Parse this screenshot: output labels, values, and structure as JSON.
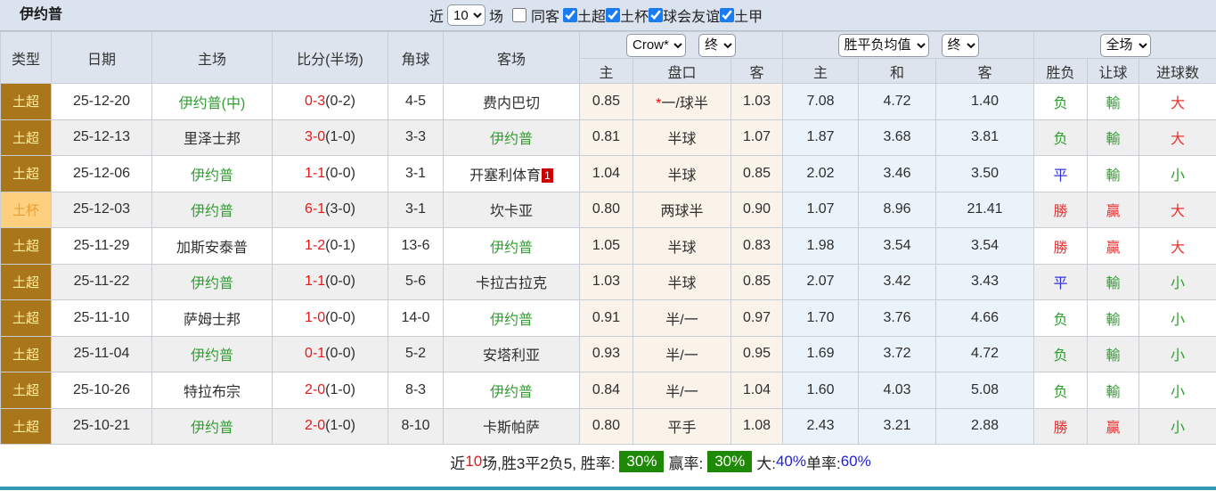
{
  "topbar": {
    "title": "伊约普",
    "recent_label": "近",
    "recent_value": "10",
    "matches_label": "场",
    "same_away": {
      "label": "同客",
      "checked": false
    },
    "leagues": [
      {
        "label": "土超",
        "checked": true
      },
      {
        "label": "土杯",
        "checked": true
      },
      {
        "label": "球会友谊",
        "checked": true
      },
      {
        "label": "土甲",
        "checked": true
      }
    ]
  },
  "header": {
    "group_cols": [
      "类型",
      "日期",
      "主场",
      "比分(半场)",
      "角球",
      "客场"
    ],
    "selects": {
      "company": "Crow*",
      "company_state": "终",
      "avg": "胜平负均值",
      "avg_state": "终",
      "scope": "全场"
    },
    "sub_cols": [
      "主",
      "盘口",
      "客",
      "主",
      "和",
      "客",
      "胜负",
      "让球",
      "进球数"
    ]
  },
  "rows": [
    {
      "type": {
        "text": "土超",
        "style": "super"
      },
      "date": "25-12-20",
      "home": {
        "text": "伊约普(中)",
        "self": true
      },
      "score": {
        "ft": "0-3",
        "ht": "(0-2)"
      },
      "corners": "4-5",
      "away": {
        "text": "费内巴切",
        "self": false
      },
      "odds": {
        "home": "0.85",
        "star": true,
        "handicap": "一/球半",
        "away": "1.03"
      },
      "avg": {
        "home": "7.08",
        "draw": "4.72",
        "away": "1.40"
      },
      "result": {
        "text": "负",
        "c": "g"
      },
      "hresult": {
        "text": "輸",
        "c": "g"
      },
      "goals": {
        "text": "大",
        "c": "r"
      }
    },
    {
      "type": {
        "text": "土超",
        "style": "super"
      },
      "date": "25-12-13",
      "home": {
        "text": "里泽士邦",
        "self": false
      },
      "score": {
        "ft": "3-0",
        "ht": "(1-0)"
      },
      "corners": "3-3",
      "away": {
        "text": "伊约普",
        "self": true
      },
      "odds": {
        "home": "0.81",
        "star": false,
        "handicap": "半球",
        "away": "1.07"
      },
      "avg": {
        "home": "1.87",
        "draw": "3.68",
        "away": "3.81"
      },
      "result": {
        "text": "负",
        "c": "g"
      },
      "hresult": {
        "text": "輸",
        "c": "g"
      },
      "goals": {
        "text": "大",
        "c": "r"
      }
    },
    {
      "type": {
        "text": "土超",
        "style": "super"
      },
      "date": "25-12-06",
      "home": {
        "text": "伊约普",
        "self": true
      },
      "score": {
        "ft": "1-1",
        "ht": "(0-0)"
      },
      "corners": "3-1",
      "away": {
        "text": "开塞利体育",
        "self": false,
        "badge": "1"
      },
      "odds": {
        "home": "1.04",
        "star": false,
        "handicap": "半球",
        "away": "0.85"
      },
      "avg": {
        "home": "2.02",
        "draw": "3.46",
        "away": "3.50"
      },
      "result": {
        "text": "平",
        "c": "b"
      },
      "hresult": {
        "text": "輸",
        "c": "g"
      },
      "goals": {
        "text": "小",
        "c": "g"
      }
    },
    {
      "type": {
        "text": "土杯",
        "style": "cup"
      },
      "date": "25-12-03",
      "home": {
        "text": "伊约普",
        "self": true
      },
      "score": {
        "ft": "6-1",
        "ht": "(3-0)"
      },
      "corners": "3-1",
      "away": {
        "text": "坎卡亚",
        "self": false
      },
      "odds": {
        "home": "0.80",
        "star": false,
        "handicap": "两球半",
        "away": "0.90"
      },
      "avg": {
        "home": "1.07",
        "draw": "8.96",
        "away": "21.41"
      },
      "result": {
        "text": "勝",
        "c": "r"
      },
      "hresult": {
        "text": "贏",
        "c": "r"
      },
      "goals": {
        "text": "大",
        "c": "r"
      }
    },
    {
      "type": {
        "text": "土超",
        "style": "super"
      },
      "date": "25-11-29",
      "home": {
        "text": "加斯安泰普",
        "self": false
      },
      "score": {
        "ft": "1-2",
        "ht": "(0-1)"
      },
      "corners": "13-6",
      "away": {
        "text": "伊约普",
        "self": true
      },
      "odds": {
        "home": "1.05",
        "star": false,
        "handicap": "半球",
        "away": "0.83"
      },
      "avg": {
        "home": "1.98",
        "draw": "3.54",
        "away": "3.54"
      },
      "result": {
        "text": "勝",
        "c": "r"
      },
      "hresult": {
        "text": "贏",
        "c": "r"
      },
      "goals": {
        "text": "大",
        "c": "r"
      }
    },
    {
      "type": {
        "text": "土超",
        "style": "super"
      },
      "date": "25-11-22",
      "home": {
        "text": "伊约普",
        "self": true
      },
      "score": {
        "ft": "1-1",
        "ht": "(0-0)"
      },
      "corners": "5-6",
      "away": {
        "text": "卡拉古拉克",
        "self": false
      },
      "odds": {
        "home": "1.03",
        "star": false,
        "handicap": "半球",
        "away": "0.85"
      },
      "avg": {
        "home": "2.07",
        "draw": "3.42",
        "away": "3.43"
      },
      "result": {
        "text": "平",
        "c": "b"
      },
      "hresult": {
        "text": "輸",
        "c": "g"
      },
      "goals": {
        "text": "小",
        "c": "g"
      }
    },
    {
      "type": {
        "text": "土超",
        "style": "super"
      },
      "date": "25-11-10",
      "home": {
        "text": "萨姆士邦",
        "self": false
      },
      "score": {
        "ft": "1-0",
        "ht": "(0-0)"
      },
      "corners": "14-0",
      "away": {
        "text": "伊约普",
        "self": true
      },
      "odds": {
        "home": "0.91",
        "star": false,
        "handicap": "半/一",
        "away": "0.97"
      },
      "avg": {
        "home": "1.70",
        "draw": "3.76",
        "away": "4.66"
      },
      "result": {
        "text": "负",
        "c": "g"
      },
      "hresult": {
        "text": "輸",
        "c": "g"
      },
      "goals": {
        "text": "小",
        "c": "g"
      }
    },
    {
      "type": {
        "text": "土超",
        "style": "super"
      },
      "date": "25-11-04",
      "home": {
        "text": "伊约普",
        "self": true
      },
      "score": {
        "ft": "0-1",
        "ht": "(0-0)"
      },
      "corners": "5-2",
      "away": {
        "text": "安塔利亚",
        "self": false
      },
      "odds": {
        "home": "0.93",
        "star": false,
        "handicap": "半/一",
        "away": "0.95"
      },
      "avg": {
        "home": "1.69",
        "draw": "3.72",
        "away": "4.72"
      },
      "result": {
        "text": "负",
        "c": "g"
      },
      "hresult": {
        "text": "輸",
        "c": "g"
      },
      "goals": {
        "text": "小",
        "c": "g"
      }
    },
    {
      "type": {
        "text": "土超",
        "style": "super"
      },
      "date": "25-10-26",
      "home": {
        "text": "特拉布宗",
        "self": false
      },
      "score": {
        "ft": "2-0",
        "ht": "(1-0)"
      },
      "corners": "8-3",
      "away": {
        "text": "伊约普",
        "self": true
      },
      "odds": {
        "home": "0.84",
        "star": false,
        "handicap": "半/一",
        "away": "1.04"
      },
      "avg": {
        "home": "1.60",
        "draw": "4.03",
        "away": "5.08"
      },
      "result": {
        "text": "负",
        "c": "g"
      },
      "hresult": {
        "text": "輸",
        "c": "g"
      },
      "goals": {
        "text": "小",
        "c": "g"
      }
    },
    {
      "type": {
        "text": "土超",
        "style": "super"
      },
      "date": "25-10-21",
      "home": {
        "text": "伊约普",
        "self": true
      },
      "score": {
        "ft": "2-0",
        "ht": "(1-0)"
      },
      "corners": "8-10",
      "away": {
        "text": "卡斯帕萨",
        "self": false
      },
      "odds": {
        "home": "0.80",
        "star": false,
        "handicap": "平手",
        "away": "1.08"
      },
      "avg": {
        "home": "2.43",
        "draw": "3.21",
        "away": "2.88"
      },
      "result": {
        "text": "勝",
        "c": "r"
      },
      "hresult": {
        "text": "贏",
        "c": "r"
      },
      "goals": {
        "text": "小",
        "c": "g"
      }
    }
  ],
  "footer": {
    "pieces": [
      {
        "text": "近",
        "c": "dark"
      },
      {
        "text": "10",
        "c": "red"
      },
      {
        "text": "场,胜3平2负5, 胜率:",
        "c": "dark"
      },
      {
        "text": "30%",
        "box": "green"
      },
      {
        "text": "赢率:",
        "c": "dark"
      },
      {
        "text": "30%",
        "box": "green"
      },
      {
        "text": "大:",
        "c": "dark"
      },
      {
        "text": "40%",
        "c": "blue"
      },
      {
        "text": "单率:",
        "c": "dark"
      },
      {
        "text": "60%",
        "c": "blue"
      }
    ]
  },
  "colors": {
    "accent_checkbox": "#1a7cf2",
    "type_super_bg": "#a9761b",
    "type_cup_bg": "#fcd07e",
    "odds_bg": "#faf3e9",
    "avg_bg": "#eaf3f9",
    "win_red": "#e83333",
    "loss_green": "#2f9e2f",
    "draw_blue": "#3131d8",
    "rate_box_green": "#1e8905",
    "bottom_bar_teal": "#2f9ab0"
  }
}
